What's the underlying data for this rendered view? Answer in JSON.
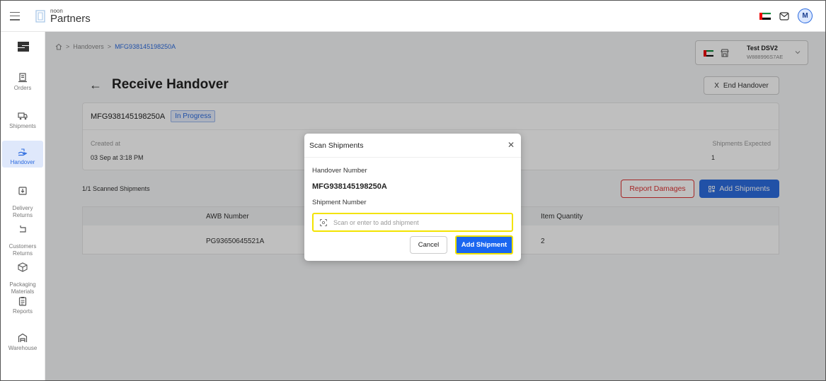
{
  "header": {
    "logo_small": "noon",
    "logo_big": "Partners",
    "avatar_initial": "M"
  },
  "sidebar": {
    "items": [
      {
        "label": "Orders"
      },
      {
        "label": "Shipments"
      },
      {
        "label": "Handover"
      },
      {
        "label": "Delivery\nReturns"
      },
      {
        "label": "Customers\nReturns"
      },
      {
        "label": "Packaging\nMaterials"
      },
      {
        "label": "Reports"
      },
      {
        "label": "Warehouse"
      }
    ]
  },
  "breadcrumb": {
    "items": [
      "Handovers",
      "MFG938145198250A"
    ]
  },
  "store": {
    "name": "Test DSV2",
    "code": "W888996S7AE"
  },
  "page": {
    "title": "Receive Handover",
    "end_label": "End Handover"
  },
  "handover": {
    "reference": "MFG938145198250A",
    "status": "In Progress",
    "created_label": "Created at",
    "created_value": "03 Sep at 3:18 PM",
    "expected_label": "Shipments Expected",
    "expected_value": "1"
  },
  "shipments": {
    "scanned_text": "1/1 Scanned Shipments",
    "report_label": "Report Damages",
    "add_label": "Add Shipments",
    "columns": {
      "awb": "AWB Number",
      "qty": "Item Quantity"
    },
    "rows": [
      {
        "awb": "PG93650645521A",
        "qty": "2"
      }
    ]
  },
  "modal": {
    "title": "Scan Shipments",
    "handover_label": "Handover Number",
    "handover_value": "MFG938145198250A",
    "shipment_label": "Shipment Number",
    "input_placeholder": "Scan or enter to add shipment",
    "cancel_label": "Cancel",
    "add_label": "Add Shipment"
  },
  "colors": {
    "accent": "#2d6cdf",
    "highlight": "#f3e300",
    "danger": "#dd3333"
  }
}
